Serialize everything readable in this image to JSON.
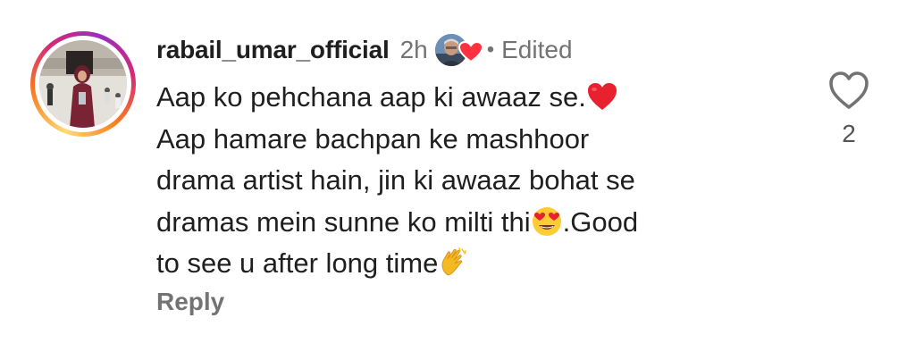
{
  "comment": {
    "username": "rabail_umar_official",
    "time": "2h",
    "separator": "•",
    "edited_label": "Edited",
    "text_lines": [
      "Aap ko pehchana aap ki awaaz se.",
      "Aap hamare bachpan ke mashhoor",
      "drama artist hain, jin ki awaaz bohat se",
      "dramas mein sunne ko milti thi",
      "to see u after long time"
    ],
    "line4_suffix": ".Good",
    "emojis": [
      "red-heart",
      "heart-eyes",
      "clapping-hands"
    ],
    "reply_label": "Reply",
    "like_count": "2",
    "liked_by_author": true
  },
  "colors": {
    "text": "#1f1f1f",
    "secondary": "#737373",
    "heart": "#ff3040"
  }
}
